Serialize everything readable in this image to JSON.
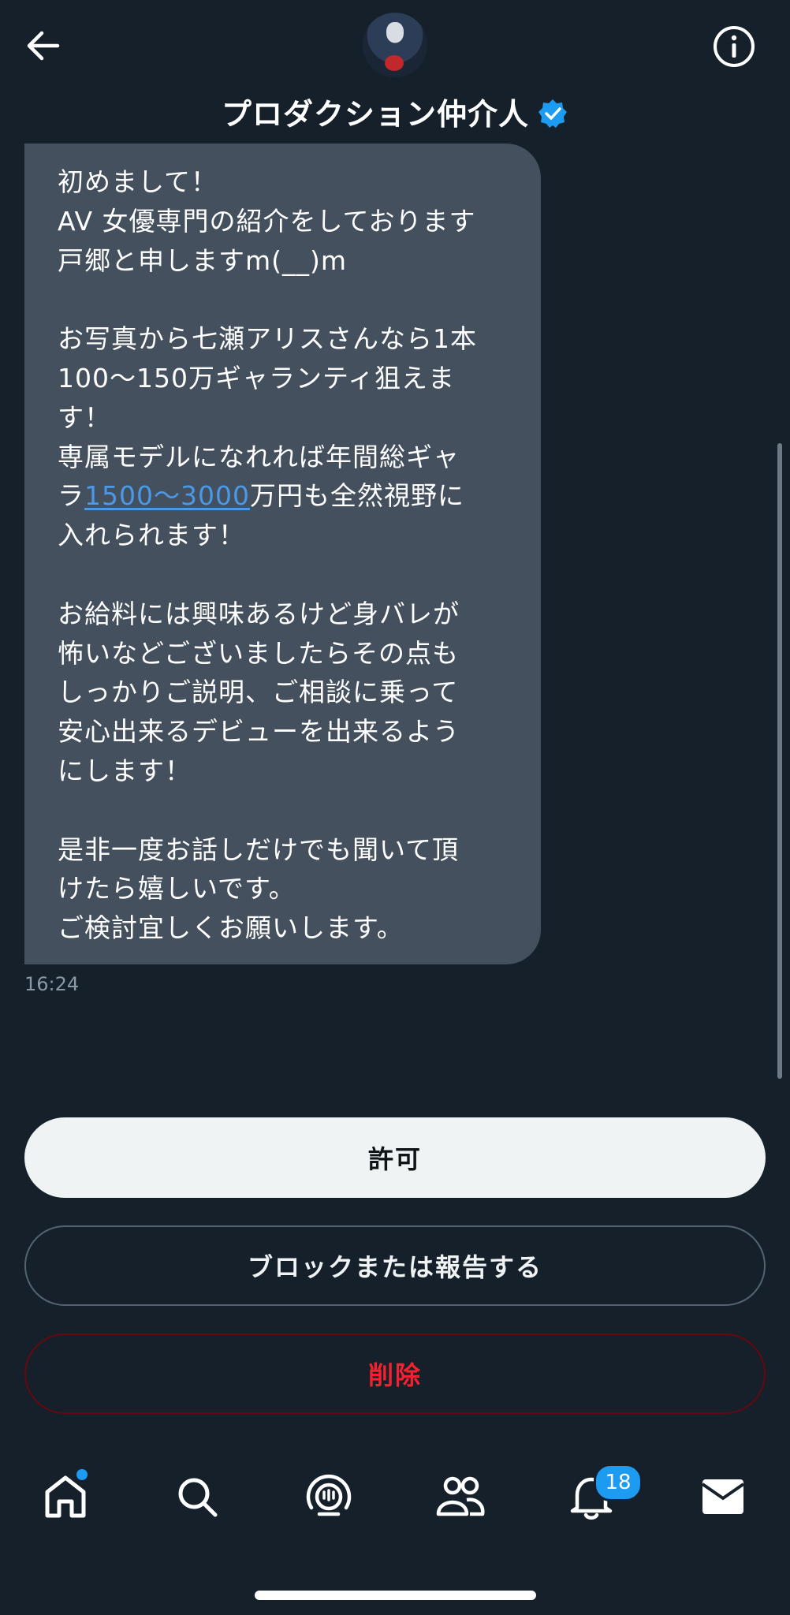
{
  "header": {
    "title": "プロダクション仲介人",
    "back_icon": "arrow-left-icon",
    "info_icon": "info-icon",
    "verified_icon": "verified-badge-icon",
    "verified_color": "#1d9bf0"
  },
  "message": {
    "lines": [
      "初めまして！",
      "AV 女優専門の紹介をしております",
      "戸郷と申しますm(__)m",
      "",
      "お写真から七瀬アリスさんなら1本",
      "100～150万ギャランティ狙えま",
      "す！",
      "専属モデルになれれば年間総ギャ",
      {
        "prefix": "ラ",
        "link": "1500～3000",
        "suffix": "万円も全然視野に"
      },
      "入れられます！",
      "",
      "お給料には興味あるけど身バレが",
      "怖いなどございましたらその点も",
      "しっかりご説明、ご相談に乗って",
      "安心出来るデビューを出来るよう",
      "にします！",
      "",
      "是非一度お話しだけでも聞いて頂",
      "けたら嬉しいです。",
      "ご検討宜しくお願いします。"
    ],
    "timestamp": "16:24",
    "link_color": "#4a99e9"
  },
  "actions": {
    "allow_label": "許可",
    "block_label": "ブロックまたは報告する",
    "delete_label": "削除",
    "delete_color": "#f4212e"
  },
  "tabbar": {
    "items": [
      {
        "name": "home",
        "icon": "home-icon",
        "has_dot": true
      },
      {
        "name": "search",
        "icon": "search-icon"
      },
      {
        "name": "spaces",
        "icon": "spaces-icon"
      },
      {
        "name": "communities",
        "icon": "communities-icon"
      },
      {
        "name": "notifications",
        "icon": "bell-icon",
        "badge": "18"
      },
      {
        "name": "messages",
        "icon": "mail-icon"
      }
    ],
    "accent": "#1d9bf0"
  }
}
